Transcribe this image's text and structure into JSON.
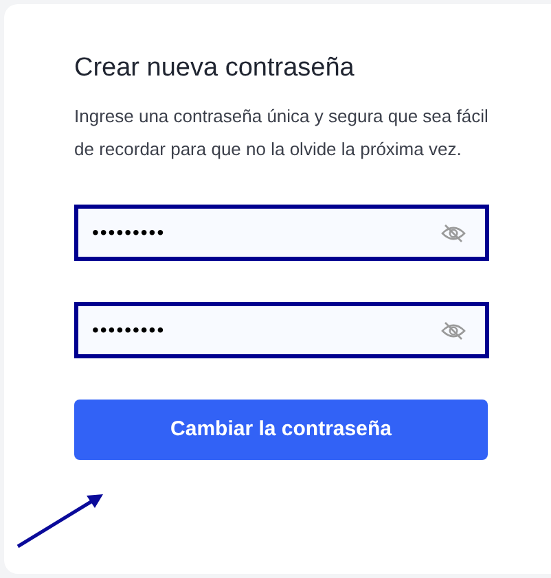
{
  "title": "Crear nueva contraseña",
  "description": "Ingrese una contraseña única y segura que sea fácil de recordar para que no la olvide la próxima vez.",
  "fields": [
    {
      "value": "•••••••••"
    },
    {
      "value": "•••••••••"
    }
  ],
  "submit_button": "Cambiar la contraseña"
}
